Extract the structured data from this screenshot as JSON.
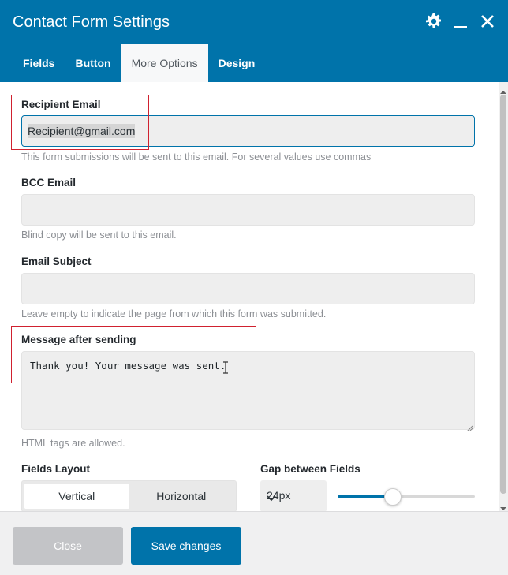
{
  "window": {
    "title": "Contact Form Settings",
    "icons": [
      "gear-icon",
      "minimize-icon",
      "close-icon"
    ]
  },
  "tabs": [
    {
      "label": "Fields",
      "active": false
    },
    {
      "label": "Button",
      "active": false
    },
    {
      "label": "More Options",
      "active": true
    },
    {
      "label": "Design",
      "active": false
    }
  ],
  "recipient": {
    "label": "Recipient Email",
    "value": "Recipient@gmail.com",
    "help": "This form submissions will be sent to this email. For several values use commas"
  },
  "bcc": {
    "label": "BCC Email",
    "value": "",
    "help": "Blind copy will be sent to this email."
  },
  "subject": {
    "label": "Email Subject",
    "value": "",
    "help": "Leave empty to indicate the page from which this form was submitted."
  },
  "message": {
    "label": "Message after sending",
    "value": "Thank you! Your message was sent.",
    "help": "HTML tags are allowed."
  },
  "layout": {
    "label": "Fields Layout",
    "options": [
      "Vertical",
      "Horizontal"
    ],
    "selected": "Vertical"
  },
  "gap": {
    "label": "Gap between Fields",
    "unit": "24px",
    "slider_fraction": 0.4
  },
  "footer": {
    "close_label": "Close",
    "save_label": "Save changes"
  },
  "colors": {
    "accent": "#0073aa",
    "highlight": "#d0212f"
  }
}
